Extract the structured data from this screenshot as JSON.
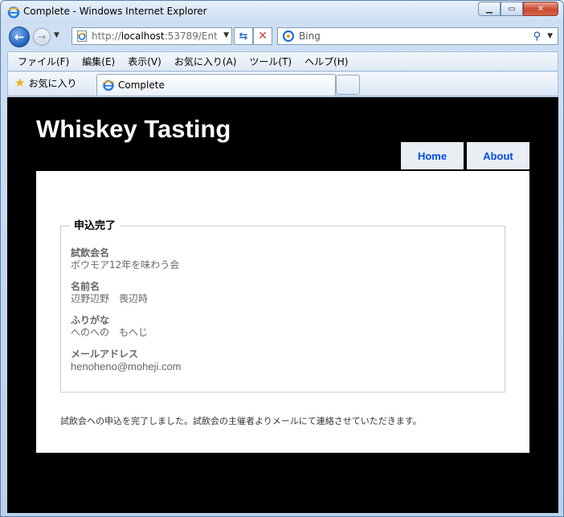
{
  "browser": {
    "window_title": "Complete - Windows Internet Explorer",
    "address_prefix": "http://",
    "address_host": "localhost",
    "address_rest": ":53789/Ent",
    "search_placeholder": "Bing",
    "menu": [
      "ファイル(F)",
      "編集(E)",
      "表示(V)",
      "お気に入り(A)",
      "ツール(T)",
      "ヘルプ(H)"
    ],
    "favorites_label": "お気に入り",
    "tab_title": "Complete"
  },
  "site": {
    "title": "Whiskey Tasting",
    "nav": {
      "home": "Home",
      "about": "About"
    }
  },
  "result": {
    "legend": "申込完了",
    "fields": [
      {
        "label": "試飲会名",
        "value": "ボウモア12年を味わう会"
      },
      {
        "label": "名前名",
        "value": "辺野辺野　喪辺時"
      },
      {
        "label": "ふりがな",
        "value": "へのへの　もへじ"
      },
      {
        "label": "メールアドレス",
        "value": "henoheno@moheji.com"
      }
    ],
    "message": "試飲会への申込を完了しました。試飲会の主催者よりメールにて連絡させていただきます。"
  }
}
